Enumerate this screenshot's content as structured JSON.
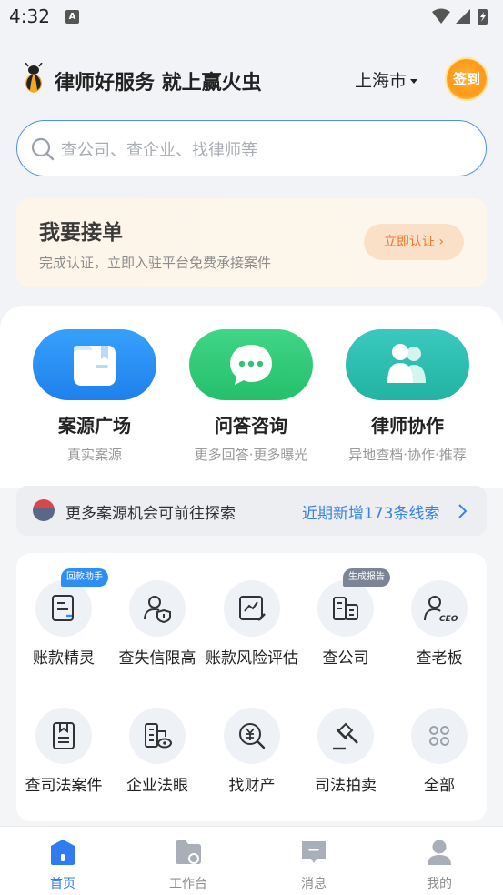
{
  "status_bar": {
    "time": "4:32",
    "badge": "A"
  },
  "header": {
    "slogan": "律师好服务 就上赢火虫",
    "city": "上海市",
    "sign_label": "签到"
  },
  "search": {
    "placeholder": "查公司、查企业、找律师等"
  },
  "order_card": {
    "title": "我要接单",
    "desc": "完成认证，立即入驻平台免费承接案件",
    "button": "立即认证 ›"
  },
  "features": [
    {
      "label": "案源广场",
      "sub": "真实案源",
      "color": "#2f8ef5"
    },
    {
      "label": "问答咨询",
      "sub": "更多回答·更多曝光",
      "color": "#33c77a"
    },
    {
      "label": "律师协作",
      "sub": "异地查档·协作·推荐",
      "color": "#30c2b0"
    }
  ],
  "explore": {
    "text": "更多案源机会可前往探索",
    "link": "近期新增173条线索"
  },
  "tools": [
    {
      "label": "账款精灵",
      "icon": "receipt-edit-icon",
      "badge": "回款助手",
      "badge_color": "#2f8ef5"
    },
    {
      "label": "查失信限高",
      "icon": "person-shield-icon"
    },
    {
      "label": "账款风险评估",
      "icon": "chart-edit-icon"
    },
    {
      "label": "查公司",
      "icon": "building-icon",
      "badge": "生成报告",
      "badge_color": "#7c8595"
    },
    {
      "label": "查老板",
      "icon": "ceo-icon"
    },
    {
      "label": "查司法案件",
      "icon": "document-icon"
    },
    {
      "label": "企业法眼",
      "icon": "building-eye-icon"
    },
    {
      "label": "找财产",
      "icon": "money-search-icon"
    },
    {
      "label": "司法拍卖",
      "icon": "gavel-icon"
    },
    {
      "label": "全部",
      "icon": "grid-icon"
    }
  ],
  "tabbar": [
    {
      "label": "首页",
      "icon": "home-icon",
      "active": true
    },
    {
      "label": "工作台",
      "icon": "folder-icon",
      "active": false
    },
    {
      "label": "消息",
      "icon": "message-icon",
      "active": false
    },
    {
      "label": "我的",
      "icon": "user-icon",
      "active": false
    }
  ]
}
